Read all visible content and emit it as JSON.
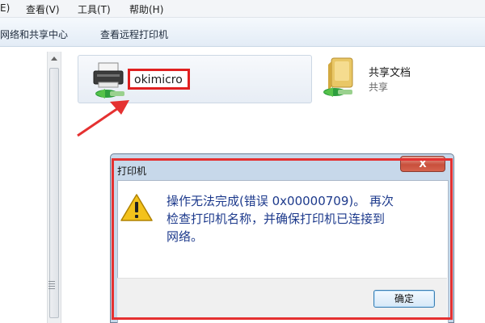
{
  "menubar": {
    "items": [
      {
        "label": "E)"
      },
      {
        "label": "查看(V)"
      },
      {
        "label": "工具(T)"
      },
      {
        "label": "帮助(H)"
      }
    ]
  },
  "toolbar": {
    "network_center_label": "网络和共享中心",
    "remote_printers_label": "查看远程打印机"
  },
  "items": {
    "printer": {
      "name": "okimicro",
      "icon": "shared-printer-icon"
    },
    "folder": {
      "name": "共享文档",
      "subtitle": "共享",
      "icon": "shared-folder-icon"
    }
  },
  "dialog": {
    "title": "打印机",
    "close_glyph": "X",
    "message_lines": [
      "操作无法完成(错误 0x00000709)。 再次",
      "检查打印机名称，并确保打印机已连接到",
      "网络。"
    ],
    "ok_label": "确定",
    "icon": "warning-icon"
  },
  "colors": {
    "highlight_red": "#e02020",
    "message_blue": "#1d3a8c"
  }
}
